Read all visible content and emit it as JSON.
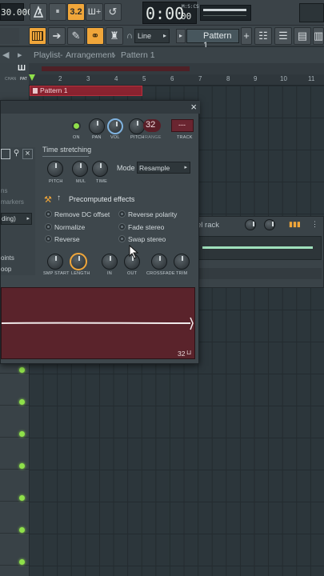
{
  "toolbar": {
    "tempo": "30.000",
    "time_display": "0:00",
    "time_centis": "00",
    "time_format": "M:S:CS",
    "pattern_number": "32",
    "icons": [
      "metronome-icon",
      "wait-icon",
      "countdown-icon",
      "step-edit-icon",
      "blend-icon"
    ]
  },
  "toolbar2": {
    "snap_mode": "Line",
    "pattern_selector": "Pattern 1",
    "icons": [
      "piano-roll-icon",
      "arrow-icon",
      "brush-icon",
      "link-icon",
      "stamp-icon"
    ]
  },
  "playlist": {
    "breadcrumb_root": "Playlist",
    "breadcrumb_sep1": "-",
    "breadcrumb_view": "Arrangement",
    "breadcrumb_sep2": "›",
    "breadcrumb_pattern": "Pattern 1",
    "subbar_labels": [
      "CHAN",
      "PAT"
    ],
    "ruler": [
      "2",
      "3",
      "4",
      "5",
      "6",
      "7",
      "8",
      "9",
      "10",
      "11"
    ],
    "clip_label": "Pattern 1"
  },
  "sampler": {
    "close_label": "×",
    "top_knobs": {
      "on": "ON",
      "pan": "PAN",
      "vol": "VOL",
      "pitch": "PITCH",
      "range_value": "32",
      "range": "RANGE",
      "track_value": "---",
      "track": "TRACK"
    },
    "left_partial": [
      "ns",
      "markers",
      "ding)",
      "oints",
      "oop"
    ],
    "time_stretching": {
      "title": "Time stretching",
      "pitch": "PITCH",
      "mul": "MUL",
      "time": "TIME",
      "mode_label": "Mode",
      "mode_value": "Resample"
    },
    "precomputed": {
      "title": "Precomputed effects",
      "options": [
        "Remove DC offset",
        "Reverse polarity",
        "Normalize",
        "Fade stereo",
        "Reverse",
        "Swap stereo"
      ]
    },
    "bottom_knobs": [
      "SMP START",
      "LENGTH",
      "IN",
      "OUT",
      "CROSSFADE",
      "TRIM"
    ],
    "wave_footer": "32"
  },
  "channel_rack": {
    "title": "el rack"
  },
  "colors": {
    "accent": "#f0a63a",
    "led_green": "#8fe04a",
    "clip_red": "#c0303c",
    "wave_bg": "#5a232b"
  }
}
